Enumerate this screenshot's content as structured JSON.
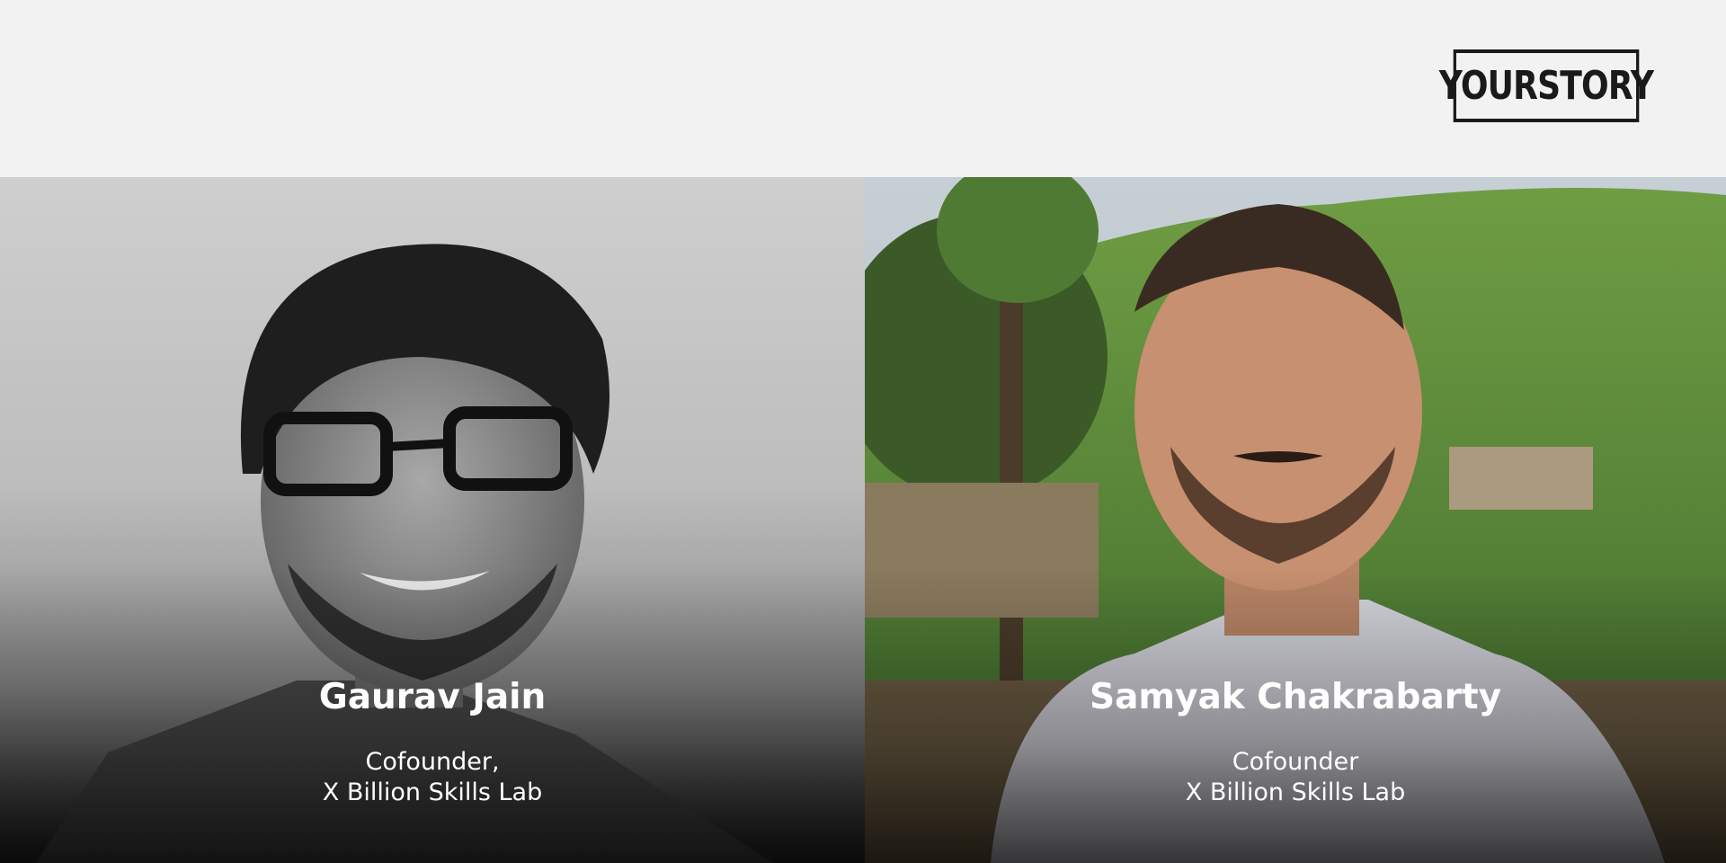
{
  "brand": {
    "logo_text": "YOURSTORY"
  },
  "profiles": [
    {
      "name": "Gaurav Jain",
      "role_line1": "Cofounder,",
      "role_line2": "X Billion Skills Lab"
    },
    {
      "name": "Samyak Chakrabarty",
      "role_line1": "Cofounder",
      "role_line2": "X Billion Skills Lab"
    }
  ],
  "colors": {
    "header_bg": "#f2f2f2",
    "caption_text": "#ffffff",
    "logo": "#1a1a1a"
  }
}
